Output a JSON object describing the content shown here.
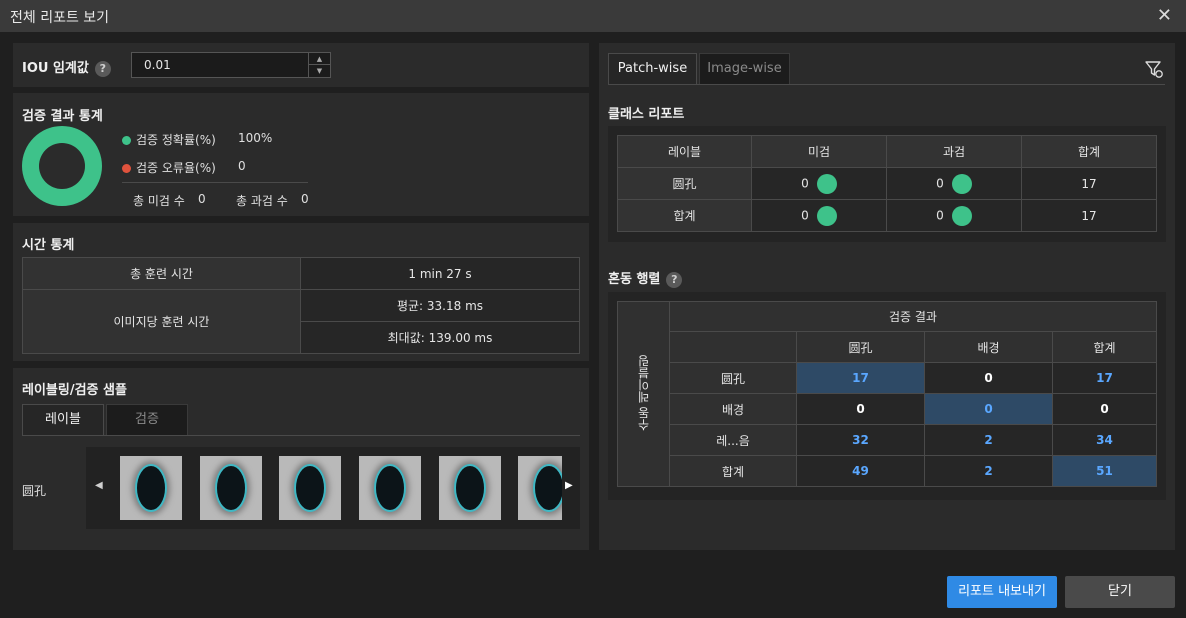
{
  "window": {
    "title": "전체 리포트 보기",
    "close": "✕"
  },
  "iou": {
    "label": "IOU 임계값",
    "help": "?",
    "value": "0.01",
    "up": "▲",
    "down": "▼"
  },
  "stats": {
    "title": "검증 결과 통계",
    "accuracy_label": "검증 정확률(%)",
    "accuracy_value": "100%",
    "error_label": "검증 오류율(%)",
    "error_value": "0",
    "missed_label": "총 미검 수",
    "missed_value": "0",
    "over_label": "총 과검 수",
    "over_value": "0",
    "accuracy_fraction": 1.0,
    "colors": {
      "accuracy": "#3ec28a",
      "error": "#e0533d"
    }
  },
  "time": {
    "title": "시간 통계",
    "total_label": "총 훈련 시간",
    "total_value": "1 min 27 s",
    "per_image_label": "이미지당 훈련 시간",
    "avg": "평균: 33.18 ms",
    "max": "최대값: 139.00 ms"
  },
  "samples": {
    "title": "레이블링/검증 샘플",
    "tabs": [
      "레이블",
      "검증"
    ],
    "row_label": "圆孔",
    "prev": "◀",
    "next": "▶"
  },
  "right_tabs": [
    "Patch-wise",
    "Image-wise"
  ],
  "class_report": {
    "title": "클래스 리포트",
    "headers": [
      "레이블",
      "미검",
      "과검",
      "합계"
    ],
    "rows": [
      {
        "label": "圆孔",
        "missed": "0",
        "over": "0",
        "total": "17"
      },
      {
        "label": "합계",
        "missed": "0",
        "over": "0",
        "total": "17"
      }
    ]
  },
  "confusion": {
    "title": "혼동 행렬",
    "help": "?",
    "top_header": "검증 결과",
    "side_header": "수동 레이블링",
    "col_headers": [
      "圆孔",
      "배경",
      "합계"
    ],
    "rows": [
      {
        "label": "圆孔",
        "cells": [
          "17",
          "0",
          "17"
        ]
      },
      {
        "label": "배경",
        "cells": [
          "0",
          "0",
          "0"
        ]
      },
      {
        "label": "레...음",
        "cells": [
          "32",
          "2",
          "34"
        ]
      },
      {
        "label": "합계",
        "cells": [
          "49",
          "2",
          "51"
        ]
      }
    ]
  },
  "buttons": {
    "export": "리포트 내보내기",
    "close": "닫기"
  }
}
